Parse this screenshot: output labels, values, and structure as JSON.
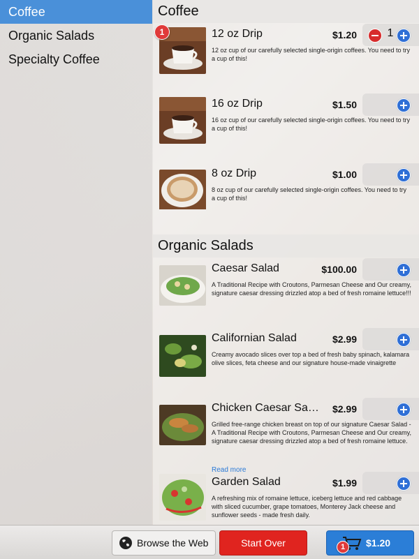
{
  "sidebar": {
    "items": [
      {
        "label": "Coffee"
      },
      {
        "label": "Organic Salads"
      },
      {
        "label": "Specialty Coffee"
      }
    ]
  },
  "sections": [
    {
      "title": "Coffee",
      "items": [
        {
          "name": "12 oz Drip",
          "price": "$1.20",
          "description": "12 oz cup of our carefully selected single-origin coffees. You need to try a cup of this!",
          "quantity": "1",
          "badge": "1"
        },
        {
          "name": "16 oz Drip",
          "price": "$1.50",
          "description": "16 oz cup of our carefully selected single-origin coffees. You need to try a cup of this!"
        },
        {
          "name": "8 oz Drip",
          "price": "$1.00",
          "description": "8 oz cup of our carefully selected single-origin coffees. You need to try a cup of this!"
        }
      ]
    },
    {
      "title": "Organic Salads",
      "items": [
        {
          "name": "Caesar Salad",
          "price": "$100.00",
          "description": "A Traditional Recipe with Croutons, Parmesan Cheese and Our creamy, signature caesar dressing drizzled atop a bed of fresh romaine lettuce!!!"
        },
        {
          "name": "Californian Salad",
          "price": "$2.99",
          "description": "Creamy avocado slices over top a bed of fresh baby spinach, kalamara olive slices, feta cheese and our signature house-made vinaigrette"
        },
        {
          "name": "Chicken Caesar Sa…",
          "price": "$2.99",
          "description": "Grilled free-range chicken breast on top of our signature Caesar Salad - A Traditional Recipe with Croutons, Parmesan Cheese and Our creamy, signature caesar dressing drizzled atop a bed of fresh romaine lettuce.",
          "read_more": "Read more"
        },
        {
          "name": "Garden Salad",
          "price": "$1.99",
          "description": "A refreshing mix of romaine lettuce, iceberg lettuce and red cabbage with sliced cucumber, grape tomatoes, Monterey Jack cheese and sunflower seeds - made fresh daily."
        }
      ]
    }
  ],
  "toolbar": {
    "browse_label": "Browse the Web",
    "start_over_label": "Start Over",
    "cart_total": "$1.20",
    "cart_badge": "1"
  },
  "icons": {
    "add": "plus-circle-icon",
    "remove": "minus-circle-icon",
    "globe": "globe-icon",
    "cart": "cart-icon"
  },
  "colors": {
    "accent": "#4a90d9",
    "add_button": "#2f6fd6",
    "remove_button": "#d72c2c",
    "start_over": "#e0241f",
    "cart_button": "#2b7ed7",
    "link": "#2a79d6"
  }
}
